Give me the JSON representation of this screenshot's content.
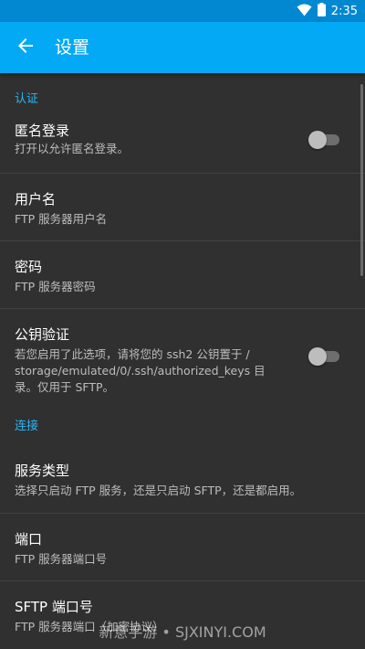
{
  "status_bar": {
    "time": "2:35",
    "wifi_icon": "wifi-icon",
    "battery_icon": "battery-icon"
  },
  "app_bar": {
    "title": "设置",
    "back_icon": "arrow-back-icon"
  },
  "sections": {
    "auth": {
      "header": "认证",
      "anonymous": {
        "title": "匿名登录",
        "summary": "打开以允许匿名登录。",
        "enabled": false
      },
      "username": {
        "title": "用户名",
        "summary": "FTP 服务器用户名"
      },
      "password": {
        "title": "密码",
        "summary": "FTP 服务器密码"
      },
      "pubkey": {
        "title": "公钥验证",
        "summary_line1": "若您启用了此选项，请将您的 ssh2 公钥置于 /",
        "summary_line2": "storage/emulated/0/.ssh/authorized_keys 目",
        "summary_line3": "录。仅用于 SFTP。",
        "enabled": false
      }
    },
    "connection": {
      "header": "连接",
      "service_type": {
        "title": "服务类型",
        "summary": "选择只启动 FTP 服务，还是只启动 SFTP，还是都启用。"
      },
      "port": {
        "title": "端口",
        "summary": "FTP 服务器端口号"
      },
      "sftp_port": {
        "title": "SFTP 端口号",
        "summary": "FTP 服务器端口（加密协议）"
      }
    }
  },
  "watermark": "新意手游 • SJXINYI.COM",
  "colors": {
    "status_bar": "#0288d1",
    "app_bar": "#03a9f4",
    "accent": "#29b6f6",
    "background": "#303030"
  }
}
